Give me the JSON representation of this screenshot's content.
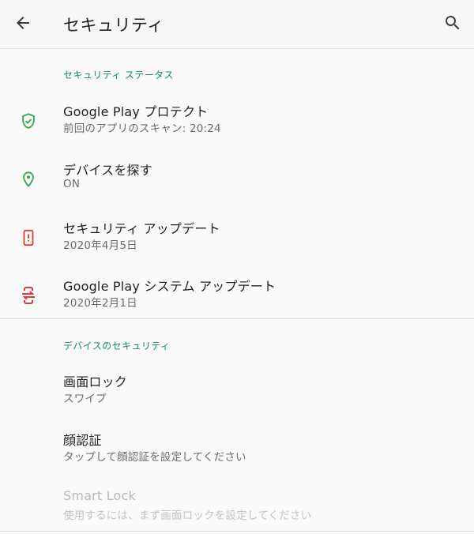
{
  "appbar": {
    "title": "セキュリティ",
    "back_icon": "arrow-back-icon",
    "search_icon": "search-icon"
  },
  "sections": [
    {
      "header": "セキュリティ ステータス",
      "items": [
        {
          "title": "Google Play プロテクト",
          "subtitle": "前回のアプリのスキャン: 20:24",
          "icon": "shield-check-icon",
          "icon_color": "#34a853"
        },
        {
          "title": "デバイスを探す",
          "subtitle": "ON",
          "icon": "location-pin-icon",
          "icon_color": "#34a853"
        },
        {
          "title": "セキュリティ アップデート",
          "subtitle": "2020年4月5日",
          "icon": "phone-alert-icon",
          "icon_color": "#e53935"
        },
        {
          "title": "Google Play システム アップデート",
          "subtitle": "2020年2月1日",
          "icon": "system-update-icon",
          "icon_color": "#e53935"
        }
      ]
    },
    {
      "header": "デバイスのセキュリティ",
      "items": [
        {
          "title": "画面ロック",
          "subtitle": "スワイプ"
        },
        {
          "title": "顔認証",
          "subtitle": "タップして顔認証を設定してください"
        },
        {
          "title": "Smart Lock",
          "subtitle": "使用するには、まず画面ロックを設定してください",
          "disabled": true
        }
      ]
    }
  ],
  "colors": {
    "accent": "#0f8a68",
    "ok": "#34a853",
    "warning": "#e53935",
    "background": "#fafafa"
  }
}
